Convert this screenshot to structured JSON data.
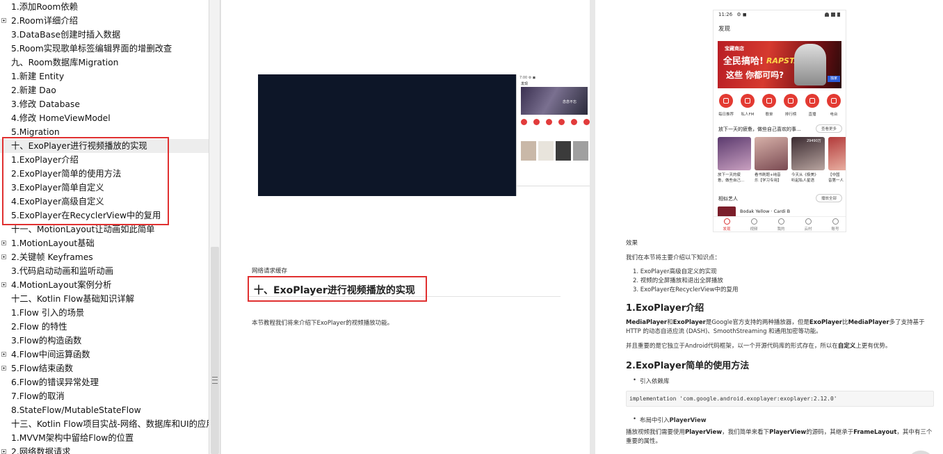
{
  "toc": {
    "items": [
      {
        "label": "1.添加Room依赖",
        "exp": false
      },
      {
        "label": "2.Room详细介绍",
        "exp": true
      },
      {
        "label": "3.DataBase创建时插入数据",
        "exp": false
      },
      {
        "label": "5.Room实现歌单标签编辑界面的增删改查",
        "exp": false
      },
      {
        "label": "九、Room数据库Migration",
        "exp": false
      },
      {
        "label": "1.新建 Entity",
        "exp": false
      },
      {
        "label": "2.新建 Dao",
        "exp": false
      },
      {
        "label": "3.修改 Database",
        "exp": false
      },
      {
        "label": "4.修改 HomeViewModel",
        "exp": false
      },
      {
        "label": "5.Migration",
        "exp": false
      },
      {
        "label": "十、ExoPlayer进行视频播放的实现",
        "exp": false
      },
      {
        "label": "1.ExoPlayer介绍",
        "exp": false
      },
      {
        "label": "2.ExoPlayer简单的使用方法",
        "exp": false
      },
      {
        "label": "3.ExoPlayer简单自定义",
        "exp": false
      },
      {
        "label": "4.ExoPlayer高级自定义",
        "exp": false
      },
      {
        "label": "5.ExoPlayer在RecyclerView中的复用",
        "exp": false
      },
      {
        "label": "十一、MotionLayout让动画如此简单",
        "exp": false
      },
      {
        "label": "1.MotionLayout基础",
        "exp": true
      },
      {
        "label": "2.关键帧 Keyframes",
        "exp": true
      },
      {
        "label": "3.代码启动动画和监听动画",
        "exp": false
      },
      {
        "label": "4.MotionLayout案例分析",
        "exp": true
      },
      {
        "label": "十二、Kotlin Flow基础知识详解",
        "exp": false
      },
      {
        "label": "1.Flow 引入的场景",
        "exp": false
      },
      {
        "label": "2.Flow 的特性",
        "exp": false
      },
      {
        "label": "3.Flow的构造函数",
        "exp": false
      },
      {
        "label": "4.Flow中间运算函数",
        "exp": true
      },
      {
        "label": "5.Flow结束函数",
        "exp": true
      },
      {
        "label": "6.Flow的错误异常处理",
        "exp": false
      },
      {
        "label": "7.Flow的取消",
        "exp": false
      },
      {
        "label": "8.StateFlow/MutableStateFlow",
        "exp": false
      },
      {
        "label": "十三、Kotlin Flow项目实战-网络、数据库和UI的应用",
        "exp": false
      },
      {
        "label": "1.MVVM架构中留给Flow的位置",
        "exp": false
      },
      {
        "label": "2.网络数据请求",
        "exp": true
      }
    ],
    "selected_index": 10
  },
  "left_page": {
    "mini_phone": {
      "status": "7:00 ⚙ ◼",
      "title": "发现",
      "banner_text": "念念不忘"
    },
    "caption_above": "网络请求缓存",
    "heading": "十、ExoPlayer进行视频播放的实现",
    "intro": "本节教程我们将来介绍下ExoPlayer的视频播放功能。"
  },
  "right_page": {
    "phone": {
      "time": "11:26",
      "status_icons": "⚙ ◼",
      "title": "发现",
      "banner": {
        "line1": "宝藏商店",
        "line2": "全民搞哈!",
        "line3": "RAPSTAR",
        "line4": "这些 你都可吗?",
        "tag": "独家"
      },
      "icons": [
        "每日推荐",
        "私人FM",
        "歌单",
        "排行榜",
        "直播",
        "电台"
      ],
      "section1": "放下一天的疲惫，做些自己喜欢的事...",
      "section1_more": "查看更多",
      "cards": [
        {
          "caption1": "放下一天的疲",
          "caption2": "惫，做些自己..."
        },
        {
          "caption1": "看书刷题+纯音",
          "caption2": "乐【学习专用】"
        },
        {
          "caption1": "今天从《极美》",
          "caption2": "听起私人星语"
        },
        {
          "caption1": "【中国",
          "caption2": "音第一人"
        }
      ],
      "card_count": "29490万",
      "section2": "相似艺人",
      "section2_more": "播放全部",
      "artist": "Bodak Yellow · Cardi B",
      "tabs": [
        "发现",
        "视频",
        "我的",
        "云村",
        "账号"
      ]
    },
    "effect_label": "效果",
    "intro": "我们在本节将主要介绍以下知识点：",
    "points": [
      "1. ExoPlayer高级自定义的实现",
      "2. 视频的全屏播放和退出全屏播放",
      "3. ExoPlayer在RecyclerView中的复用"
    ],
    "h1": "1.ExoPlayer介绍",
    "p1": {
      "a": "MediaPlayer",
      "b": "和",
      "c": "ExoPlayer",
      "d": "是Google官方支持的两种播放器，但是",
      "e": "ExoPlayer",
      "f": "比",
      "g": "MediaPlayer",
      "h": "多了支持基于 HTTP 的动态自适应流 (DASH)、SmoothStreaming 和通用加密等功能。"
    },
    "p2": {
      "a": "并且重要的是它独立于Android代码框架，以一个开源代码库的形式存在，所以在",
      "b": "自定义",
      "c": "上更有优势。"
    },
    "h2": "2.ExoPlayer简单的使用方法",
    "bullet1": "引入依赖库",
    "code": "implementation 'com.google.android.exoplayer:exoplayer:2.12.0'",
    "bullet2_a": "布局中引入",
    "bullet2_b": "PlayerView",
    "p3": {
      "a": "播放视频我们需要使用",
      "b": "PlayerView",
      "c": "，我们简单来看下",
      "d": "PlayerView",
      "e": "的源码，其继承于",
      "f": "FrameLayout",
      "g": "，其中有三个重要的属性。"
    }
  }
}
